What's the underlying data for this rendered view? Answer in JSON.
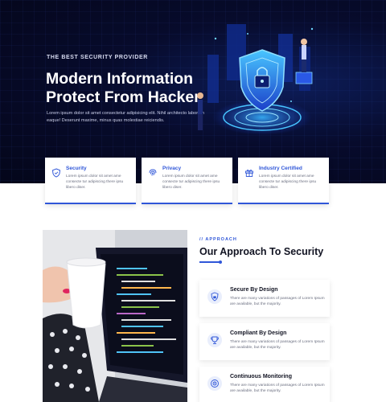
{
  "hero": {
    "eyebrow": "THE BEST SECURITY PROVIDER",
    "title": "Modern Information Protect From Hacker",
    "description": "Lorem ipsum dolor sit amet consectetur adipisicing elit. Nihil architecto laborum eaque! Deserunt maxime, minus quas molestiae reiciendis."
  },
  "features": [
    {
      "title": "Security",
      "description": "Lorem ipsum dolor sit amet ame consecte tur adipiscing there ipsu libero diser.",
      "icon": "shield-icon"
    },
    {
      "title": "Privacy",
      "description": "Lorem ipsum dolor sit amet ame consecte tur adipiscing there ipsu libero diser.",
      "icon": "fingerprint-icon"
    },
    {
      "title": "Industry Certified",
      "description": "Lorem ipsum dolor sit amet ame consecte tur adipiscing there ipsu libero diser.",
      "icon": "gift-icon"
    }
  ],
  "approach": {
    "label": "// APPROACH",
    "title": "Our Approach To Security",
    "items": [
      {
        "title": "Secure By Design",
        "description": "There are many variations of passages of Lorem Ipsum are available, but the majority.",
        "icon": "lock-shield-icon"
      },
      {
        "title": "Compliant By Design",
        "description": "There are many variations of passages of Lorem Ipsum are available, but the majority.",
        "icon": "trophy-icon"
      },
      {
        "title": "Continuous Monitoring",
        "description": "There are many variations of passages of Lorem Ipsum are available, but the majority.",
        "icon": "monitor-target-icon"
      }
    ]
  },
  "colors": {
    "accent": "#2f56d8",
    "hero_bg": "#060a26",
    "text_dark": "#111322"
  }
}
